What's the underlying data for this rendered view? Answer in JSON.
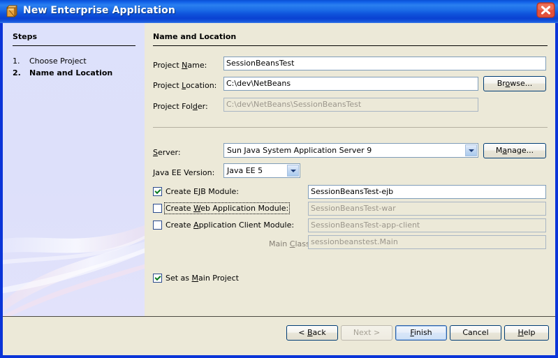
{
  "window": {
    "title": "New Enterprise Application",
    "icon": "module-box-icon",
    "close_label": "Close",
    "title_gradient_start": "#2a7ff0",
    "title_gradient_end": "#0a41d2",
    "close_color": "#d94a38",
    "dialog_bg": "#ece9d8",
    "sidebar_bg": "#dde1fb",
    "frame_color": "#0a34d8"
  },
  "sidebar": {
    "heading": "Steps",
    "steps": [
      {
        "number": "1.",
        "label": "Choose Project",
        "current": false
      },
      {
        "number": "2.",
        "label": "Name and Location",
        "current": true
      }
    ]
  },
  "content": {
    "heading": "Name and Location",
    "fields": {
      "project_name": {
        "label_pre": "Project ",
        "label_mn": "N",
        "label_post": "ame:",
        "value": "SessionBeansTest",
        "enabled": true
      },
      "project_location": {
        "label_pre": "Project ",
        "label_mn": "L",
        "label_post": "ocation:",
        "value": "C:\\dev\\NetBeans",
        "enabled": true,
        "button": {
          "pre": "Br",
          "mn": "o",
          "post": "wse..."
        }
      },
      "project_folder": {
        "label_pre": "Project Fol",
        "label_mn": "d",
        "label_post": "er:",
        "value": "C:\\dev\\NetBeans\\SessionBeansTest",
        "enabled": false
      },
      "server": {
        "label_pre": "",
        "label_mn": "S",
        "label_post": "erver:",
        "value": "Sun Java System Application Server 9",
        "button": {
          "pre": "M",
          "mn": "a",
          "post": "nage..."
        }
      },
      "java_ee_version": {
        "label_pre": "",
        "label_mn": "J",
        "label_post": "ava EE Version:",
        "value": "Java EE 5"
      },
      "create_ejb_module": {
        "label_pre": "Create E",
        "label_mn": "J",
        "label_post": "B Module:",
        "checked": true,
        "focused": false,
        "value": "SessionBeansTest-ejb",
        "enabled": true
      },
      "create_web_module": {
        "label_pre": "Create ",
        "label_mn": "W",
        "label_post": "eb Application Module:",
        "checked": false,
        "focused": true,
        "value": "SessionBeansTest-war",
        "enabled": false
      },
      "create_app_client_module": {
        "label_pre": "Create ",
        "label_mn": "A",
        "label_post": "pplication Client Module:",
        "checked": false,
        "focused": false,
        "value": "SessionBeansTest-app-client",
        "enabled": false
      },
      "main_class": {
        "label_pre": "Main ",
        "label_mn": "C",
        "label_post": "lass:",
        "value": "sessionbeanstest.Main",
        "enabled": false
      },
      "set_as_main_project": {
        "label_pre": "Set as ",
        "label_mn": "M",
        "label_post": "ain Project",
        "checked": true,
        "focused": false
      }
    }
  },
  "buttons": {
    "back": {
      "pre": "< ",
      "mn": "B",
      "post": "ack",
      "enabled": true,
      "default": false
    },
    "next": {
      "pre": "",
      "mn": "",
      "post": "Next >",
      "enabled": false,
      "default": false
    },
    "finish": {
      "pre": "",
      "mn": "F",
      "post": "inish",
      "enabled": true,
      "default": true
    },
    "cancel": {
      "pre": "",
      "mn": "",
      "post": "Cancel",
      "enabled": true,
      "default": false
    },
    "help": {
      "pre": "",
      "mn": "H",
      "post": "elp",
      "enabled": true,
      "default": false
    }
  }
}
